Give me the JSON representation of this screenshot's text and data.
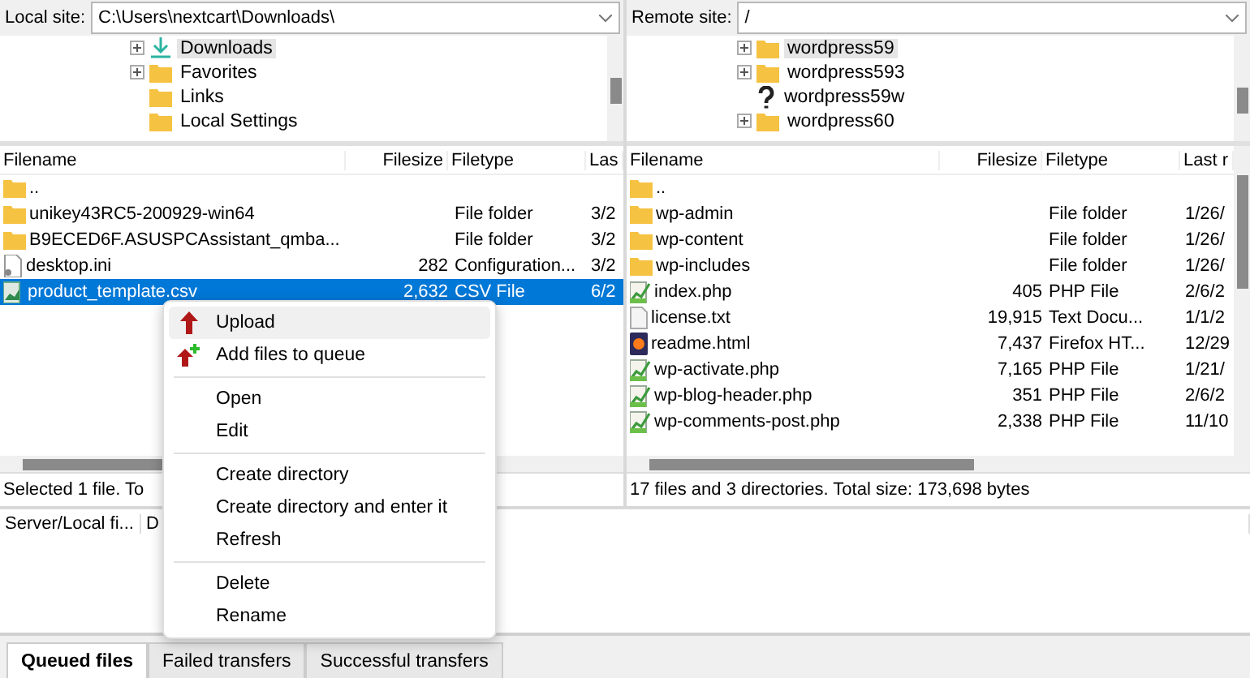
{
  "local": {
    "label": "Local site:",
    "path": "C:\\Users\\nextcart\\Downloads\\",
    "tree": [
      {
        "name": "Downloads",
        "kind": "download",
        "expandable": true,
        "selected": true
      },
      {
        "name": "Favorites",
        "kind": "folder",
        "expandable": true,
        "selected": false
      },
      {
        "name": "Links",
        "kind": "folder",
        "expandable": false,
        "selected": false
      },
      {
        "name": "Local Settings",
        "kind": "folder",
        "expandable": false,
        "selected": false
      }
    ],
    "columns": [
      "Filename",
      "Filesize",
      "Filetype",
      "Las"
    ],
    "rows": [
      {
        "name": "..",
        "size": "",
        "type": "",
        "date": "",
        "kind": "folder",
        "selected": false
      },
      {
        "name": "unikey43RC5-200929-win64",
        "size": "",
        "type": "File folder",
        "date": "3/2",
        "kind": "folder",
        "selected": false
      },
      {
        "name": "B9ECED6F.ASUSPCAssistant_qmba...",
        "size": "",
        "type": "File folder",
        "date": "3/2",
        "kind": "folder",
        "selected": false
      },
      {
        "name": "desktop.ini",
        "size": "282",
        "type": "Configuration...",
        "date": "3/2",
        "kind": "settings",
        "selected": false
      },
      {
        "name": "product_template.csv",
        "size": "2,632",
        "type": "CSV File",
        "date": "6/2",
        "kind": "sheet",
        "selected": true
      }
    ],
    "status": "Selected 1 file. To"
  },
  "remote": {
    "label": "Remote site:",
    "path": "/",
    "tree": [
      {
        "name": "wordpress59",
        "kind": "folder",
        "expandable": true,
        "selected": true
      },
      {
        "name": "wordpress593",
        "kind": "folder",
        "expandable": true,
        "selected": false
      },
      {
        "name": "wordpress59w",
        "kind": "unknown",
        "expandable": false,
        "selected": false
      },
      {
        "name": "wordpress60",
        "kind": "folder",
        "expandable": true,
        "selected": false
      }
    ],
    "columns": [
      "Filename",
      "Filesize",
      "Filetype",
      "Last r"
    ],
    "rows": [
      {
        "name": "..",
        "size": "",
        "type": "",
        "date": "",
        "kind": "folder",
        "selected": false
      },
      {
        "name": "wp-admin",
        "size": "",
        "type": "File folder",
        "date": "1/26/",
        "kind": "folder",
        "selected": false
      },
      {
        "name": "wp-content",
        "size": "",
        "type": "File folder",
        "date": "1/26/",
        "kind": "folder",
        "selected": false
      },
      {
        "name": "wp-includes",
        "size": "",
        "type": "File folder",
        "date": "1/26/",
        "kind": "folder",
        "selected": false
      },
      {
        "name": "index.php",
        "size": "405",
        "type": "PHP File",
        "date": "2/6/2",
        "kind": "script",
        "selected": false
      },
      {
        "name": "license.txt",
        "size": "19,915",
        "type": "Text Docu...",
        "date": "1/1/2",
        "kind": "text",
        "selected": false
      },
      {
        "name": "readme.html",
        "size": "7,437",
        "type": "Firefox HT...",
        "date": "12/29",
        "kind": "web",
        "selected": false
      },
      {
        "name": "wp-activate.php",
        "size": "7,165",
        "type": "PHP File",
        "date": "1/21/",
        "kind": "script",
        "selected": false
      },
      {
        "name": "wp-blog-header.php",
        "size": "351",
        "type": "PHP File",
        "date": "2/6/2",
        "kind": "script",
        "selected": false
      },
      {
        "name": "wp-comments-post.php",
        "size": "2,338",
        "type": "PHP File",
        "date": "11/10",
        "kind": "script",
        "selected": false
      }
    ],
    "status": "17 files and 3 directories. Total size: 173,698 bytes"
  },
  "queue": {
    "columns": [
      "Server/Local fi...",
      "D"
    ]
  },
  "context_menu": [
    [
      {
        "label": "Upload",
        "kind": "upload",
        "highlighted": true
      },
      {
        "label": "Add files to queue",
        "kind": "queue",
        "highlighted": false
      }
    ],
    [
      {
        "label": "Open",
        "kind": "plain",
        "highlighted": false
      },
      {
        "label": "Edit",
        "kind": "plain",
        "highlighted": false
      }
    ],
    [
      {
        "label": "Create directory",
        "kind": "plain",
        "highlighted": false
      },
      {
        "label": "Create directory and enter it",
        "kind": "plain",
        "highlighted": false
      },
      {
        "label": "Refresh",
        "kind": "plain",
        "highlighted": false
      }
    ],
    [
      {
        "label": "Delete",
        "kind": "plain",
        "highlighted": false
      },
      {
        "label": "Rename",
        "kind": "plain",
        "highlighted": false
      }
    ]
  ],
  "tabs": [
    {
      "label": "Queued files",
      "selected": true
    },
    {
      "label": "Failed transfers",
      "selected": false
    },
    {
      "label": "Successful transfers",
      "selected": false
    }
  ]
}
